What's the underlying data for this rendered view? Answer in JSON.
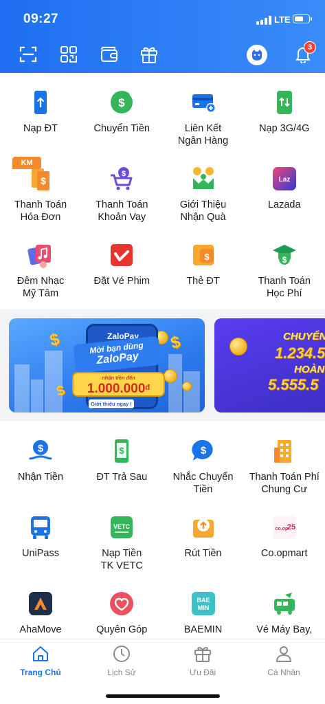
{
  "status_bar": {
    "time": "09:27",
    "network": "LTE"
  },
  "header": {
    "notification_count": "3",
    "icons": [
      "scan-icon",
      "qr-code-icon",
      "wallet-icon",
      "gift-icon",
      "avatar-icon",
      "bell-icon"
    ]
  },
  "services_top": [
    {
      "label": "Nạp ĐT",
      "icon": "phone-topup-icon"
    },
    {
      "label": "Chuyển Tiền",
      "icon": "transfer-icon"
    },
    {
      "label": "Liên Kết\nNgân Hàng",
      "icon": "bank-link-icon"
    },
    {
      "label": "Nạp 3G/4G",
      "icon": "data-topup-icon"
    },
    {
      "label": "Thanh Toán\nHóa Đơn",
      "icon": "bill-icon",
      "badge": "KM"
    },
    {
      "label": "Thanh Toán\nKhoản Vay",
      "icon": "loan-icon"
    },
    {
      "label": "Giới Thiệu\nNhận Quà",
      "icon": "referral-icon"
    },
    {
      "label": "Lazada",
      "icon": "lazada-icon"
    },
    {
      "label": "Đêm Nhạc\nMỹ Tâm",
      "icon": "music-icon"
    },
    {
      "label": "Đặt Vé Phim",
      "icon": "movie-icon"
    },
    {
      "label": "Thẻ ĐT",
      "icon": "phone-card-icon"
    },
    {
      "label": "Thanh Toán\nHọc Phí",
      "icon": "tuition-icon"
    }
  ],
  "banner": {
    "logo": "ZaloPay",
    "line1": "Mời bạn dùng",
    "line2": "ZaloPay",
    "small": "nhận tiền đến",
    "amount": "1.000.000",
    "currency": "đ",
    "cta": "Giới thiệu ngay !",
    "banner2_line1": "CHUYỂN",
    "banner2_line2": "1.234.5",
    "banner2_line3": "HOÀN",
    "banner2_line4": "5.555.5"
  },
  "services_bottom": [
    {
      "label": "Nhận Tiền",
      "icon": "receive-money-icon"
    },
    {
      "label": "ĐT Trả Sau",
      "icon": "postpaid-icon"
    },
    {
      "label": "Nhắc Chuyển\nTiền",
      "icon": "reminder-icon"
    },
    {
      "label": "Thanh Toán Phí\nChung Cư",
      "icon": "apartment-icon"
    },
    {
      "label": "UniPass",
      "icon": "bus-icon"
    },
    {
      "label": "Nạp Tiền\nTK VETC",
      "icon": "vetc-icon"
    },
    {
      "label": "Rút Tiền",
      "icon": "withdraw-icon"
    },
    {
      "label": "Co.opmart",
      "icon": "coopmart-icon"
    },
    {
      "label": "AhaMove",
      "icon": "ahamove-icon"
    },
    {
      "label": "Quyên Góp",
      "icon": "donate-icon"
    },
    {
      "label": "BAEMIN",
      "icon": "baemin-icon"
    },
    {
      "label": "Vé Máy Bay,",
      "icon": "transport-ticket-icon"
    }
  ],
  "tabbar": [
    {
      "label": "Trang Chủ",
      "icon": "home-icon",
      "active": true
    },
    {
      "label": "Lịch Sử",
      "icon": "clock-icon"
    },
    {
      "label": "Ưu Đãi",
      "icon": "gift-icon"
    },
    {
      "label": "Cá Nhân",
      "icon": "user-icon"
    }
  ]
}
